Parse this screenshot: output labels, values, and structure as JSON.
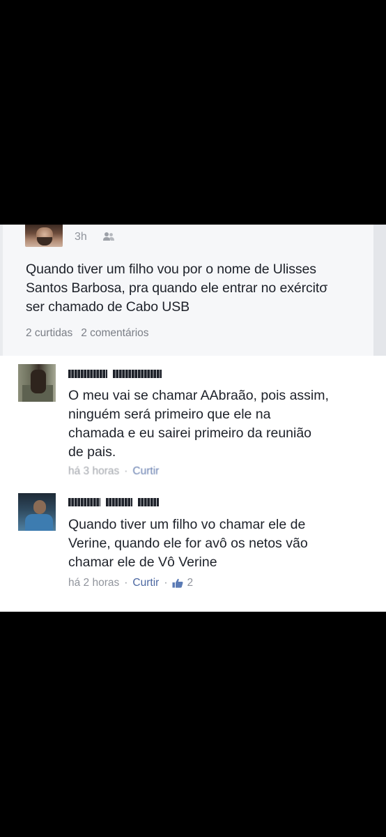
{
  "post": {
    "time": "3h",
    "audience_icon": "friends-icon",
    "text_lines": [
      "Quando tiver um filho vou por o nome de Ulisses",
      "Santos Barbosa, pra quando ele entrar no exércitσ",
      "ser chamado de Cabo USB"
    ],
    "likes": "2 curtidas",
    "comments": "2 comentários"
  },
  "comments": [
    {
      "text_lines": [
        "O meu vai se chamar AAbraão, pois assim,",
        "ninguém será primeiro que ele na",
        "chamada e eu sairei primeiro da reunião",
        "de pais."
      ],
      "time": "há 3 horas",
      "like_label": "Curtir"
    },
    {
      "text_lines": [
        "Quando tiver um filho vo chamar ele de",
        "Verine, quando ele for avô os netos vão",
        "chamar ele de Vô Verine"
      ],
      "time": "há 2 horas",
      "like_label": "Curtir",
      "like_icon": "thumbs-up-icon",
      "like_count": "2"
    }
  ],
  "colors": {
    "background": "#000000",
    "card": "#ffffff",
    "post_background": "#f6f7f9",
    "text": "#1d2129",
    "meta": "#90949c",
    "link": "#4b67a1"
  }
}
